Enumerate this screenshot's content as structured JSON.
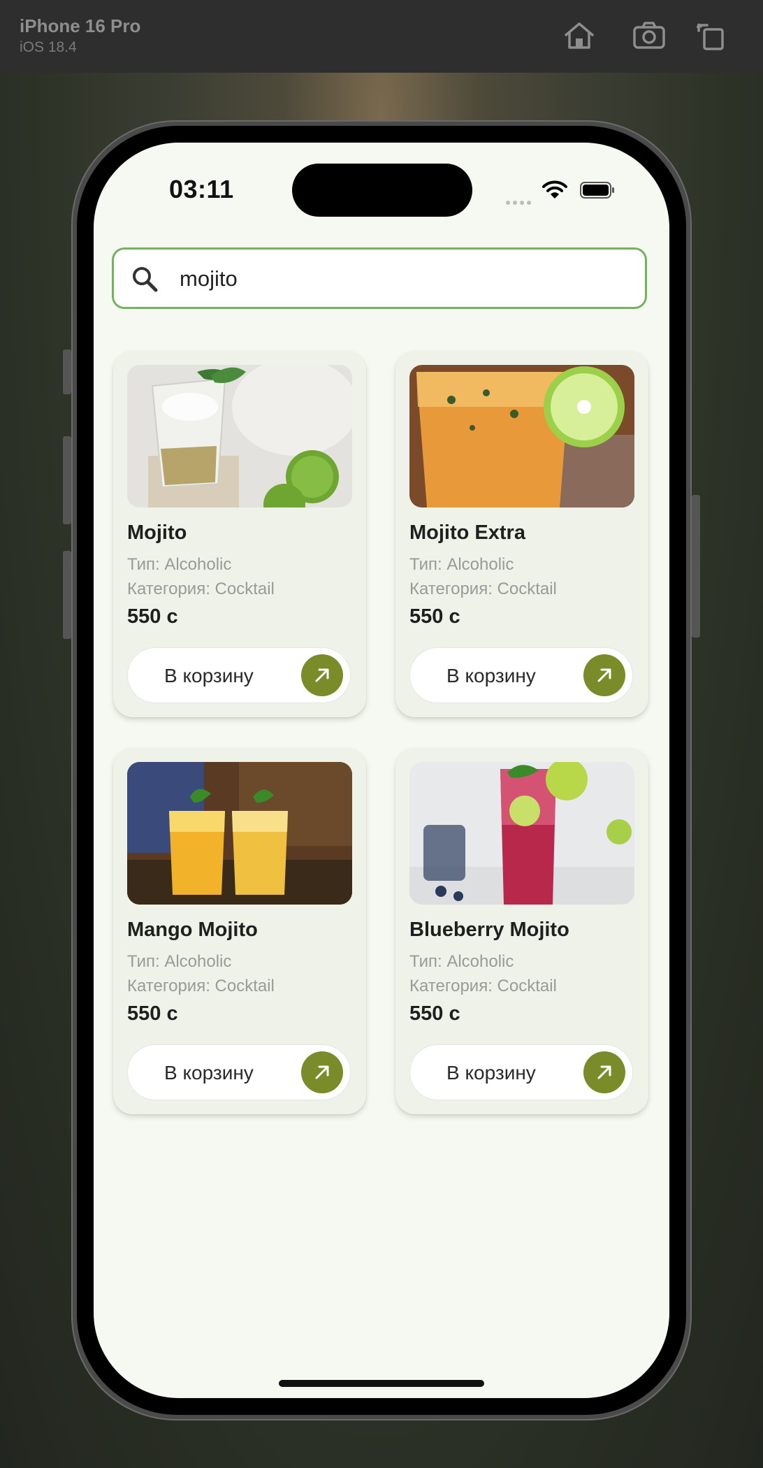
{
  "simulator": {
    "device": "iPhone 16 Pro",
    "os": "iOS 18.4",
    "icons": [
      "home-icon",
      "screenshot-icon",
      "rotate-icon"
    ]
  },
  "status_bar": {
    "time": "03:11"
  },
  "search": {
    "value": "mojito",
    "accent_color": "#74b25d"
  },
  "products": [
    {
      "name": "Mojito",
      "type": "Тип: Alcoholic",
      "category": "Категория: Cocktail",
      "price": "550 с",
      "cart_label": "В корзину"
    },
    {
      "name": "Mojito Extra",
      "type": "Тип: Alcoholic",
      "category": "Категория: Cocktail",
      "price": "550 с",
      "cart_label": "В корзину"
    },
    {
      "name": "Mango Mojito",
      "type": "Тип: Alcoholic",
      "category": "Категория: Cocktail",
      "price": "550 с",
      "cart_label": "В корзину"
    },
    {
      "name": "Blueberry Mojito",
      "type": "Тип: Alcoholic",
      "category": "Категория: Cocktail",
      "price": "550 с",
      "cart_label": "В корзину"
    }
  ],
  "colors": {
    "cart_button_accent": "#7a8c2a",
    "card_background": "#eef2e8",
    "screen_background": "#f6f9f1"
  }
}
